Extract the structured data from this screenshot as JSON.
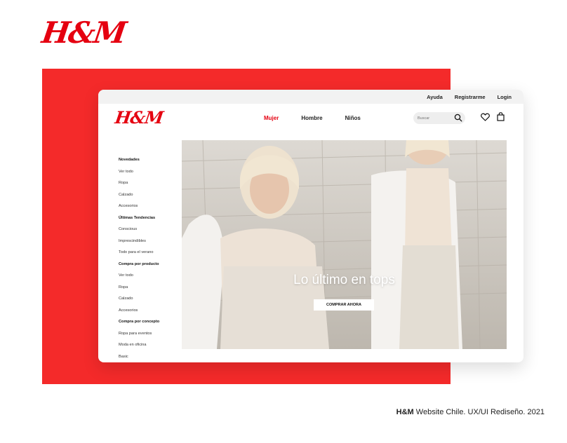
{
  "brand": {
    "logo": "H&M"
  },
  "topbar": {
    "links": [
      "Ayuda",
      "Registrarme",
      "Login"
    ]
  },
  "header": {
    "logo": "H&M",
    "nav": [
      "Mujer",
      "Hombre",
      "Niños"
    ],
    "active_nav": "Mujer",
    "search_placeholder": "Buscar",
    "icons": [
      "search-icon",
      "heart-icon",
      "bag-icon"
    ]
  },
  "sidebar": {
    "sections": [
      {
        "heading": "Novedades",
        "items": [
          "Ver todo",
          "Ropa",
          "Calzado",
          "Accesorios"
        ]
      },
      {
        "heading": "Últimas Tendencias",
        "items": [
          "Conscious",
          "Imprescindibles",
          "Todo para el verano"
        ]
      },
      {
        "heading": "Compra por producto",
        "items": [
          "Ver todo",
          "Ropa",
          "Calzado",
          "Accesorios"
        ]
      },
      {
        "heading": "Compra por concepto",
        "items": [
          "Ropa para eventos",
          "Moda en oficina",
          "Basic"
        ]
      }
    ]
  },
  "hero": {
    "title": "Lo último en tops",
    "cta_label": "COMPRAR AHORA"
  },
  "caption": {
    "brand": "H&M",
    "text": " Website Chile. UX/UI Rediseño. 2021"
  },
  "colors": {
    "brand_red": "#e50010",
    "panel_red": "#f42a2a",
    "topbar_bg": "#f2f2f2"
  }
}
